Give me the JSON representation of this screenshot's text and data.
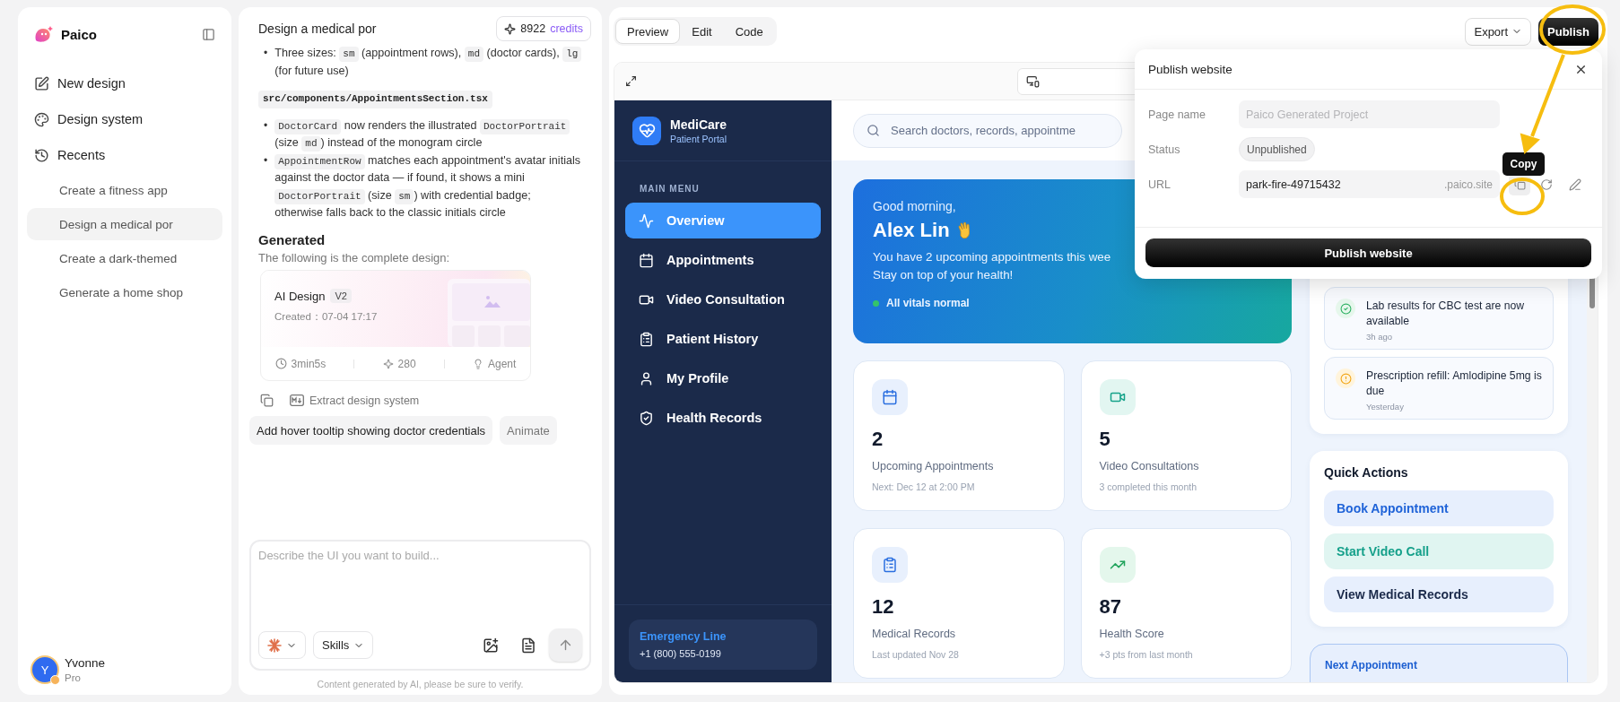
{
  "sidebar": {
    "brand": "Paico",
    "nav": [
      {
        "label": "New design"
      },
      {
        "label": "Design system"
      },
      {
        "label": "Recents"
      }
    ],
    "recents": [
      {
        "label": "Create a fitness app",
        "selected": false
      },
      {
        "label": "Design a medical por",
        "selected": true
      },
      {
        "label": "Create a dark-themed",
        "selected": false
      },
      {
        "label": "Generate a home shop",
        "selected": false
      }
    ],
    "user": {
      "initial": "Y",
      "name": "Yvonne",
      "plan": "Pro"
    }
  },
  "chat": {
    "title": "Design a medical por",
    "credits": {
      "amount": "8922",
      "label": "credits"
    },
    "blocks": [
      {
        "kind": "bullets",
        "marker": "•",
        "items": [
          [
            {
              "kind": "text",
              "text": "Three sizes: "
            },
            {
              "kind": "code",
              "text": "sm"
            },
            {
              "kind": "text",
              "text": " (appointment rows), "
            },
            {
              "kind": "code",
              "text": "md"
            },
            {
              "kind": "text",
              "text": " (doctor cards), "
            },
            {
              "kind": "code",
              "text": "lg"
            },
            {
              "kind": "text",
              "text": " (for future use)"
            }
          ]
        ]
      },
      {
        "kind": "code",
        "text": "src/components/AppointmentsSection.tsx"
      },
      {
        "kind": "bullets",
        "marker": "•",
        "items": [
          [
            {
              "kind": "code",
              "text": "DoctorCard"
            },
            {
              "kind": "text",
              "text": " now renders the illustrated "
            },
            {
              "kind": "code",
              "text": "DoctorPortrait"
            },
            {
              "kind": "text",
              "text": " (size "
            },
            {
              "kind": "code",
              "text": "md"
            },
            {
              "kind": "text",
              "text": ") instead of the monogram circle"
            }
          ],
          [
            {
              "kind": "code",
              "text": "AppointmentRow"
            },
            {
              "kind": "text",
              "text": " matches each appointment's avatar initials against the doctor data — if found, it shows a mini "
            },
            {
              "kind": "code",
              "text": "DoctorPortrait"
            },
            {
              "kind": "text",
              "text": " (size "
            },
            {
              "kind": "code",
              "text": "sm"
            },
            {
              "kind": "text",
              "text": ") with credential badge; otherwise falls back to the classic initials circle"
            }
          ]
        ]
      },
      {
        "kind": "heading",
        "text": "Generated"
      },
      {
        "kind": "paragraph",
        "text": "The following is the complete design:"
      }
    ],
    "design": {
      "title": "AI Design",
      "version": "V2",
      "created": "Created：07-04 17:17",
      "duration": "3min5s",
      "credits": "280",
      "mode": "Agent"
    },
    "actions": {
      "extract": "Extract design system"
    },
    "suggestions": [
      "Add hover tooltip showing doctor credentials",
      "Animate"
    ],
    "input": {
      "placeholder": "Describe the UI you want to build...",
      "skills": "Skills"
    },
    "disclaimer": "Content  generated by AI, please be sure to verify."
  },
  "editor": {
    "tabs": [
      {
        "label": "Preview",
        "selected": true
      },
      {
        "label": "Edit",
        "selected": false
      },
      {
        "label": "Code",
        "selected": false
      }
    ],
    "export": "Export",
    "publish": "Publish"
  },
  "preview": {
    "brand": "MediCare",
    "subtitle": "Patient Portal",
    "menu_title": "MAIN MENU",
    "menu": [
      {
        "label": "Overview",
        "selected": true
      },
      {
        "label": "Appointments",
        "selected": false
      },
      {
        "label": "Video Consultation",
        "selected": false
      },
      {
        "label": "Patient History",
        "selected": false
      },
      {
        "label": "My Profile",
        "selected": false
      },
      {
        "label": "Health Records",
        "selected": false
      }
    ],
    "emergency": {
      "title": "Emergency Line",
      "phone": "+1 (800) 555-0199"
    },
    "search": {
      "placeholder": "Search doctors, records, appointme"
    },
    "greeting": {
      "hello": "Good morning,",
      "name": "Alex Lin",
      "lines": [
        "You have 2 upcoming appointments this wee",
        "Stay on top of your health!"
      ],
      "status": "All vitals normal"
    },
    "stats": [
      {
        "value": "2",
        "label": "Upcoming Appointments",
        "note": "Next: Dec 12 at 2:00 PM"
      },
      {
        "value": "5",
        "label": "Video Consultations",
        "note": "3 completed this month"
      },
      {
        "value": "12",
        "label": "Medical Records",
        "note": "Last updated Nov 28"
      },
      {
        "value": "87",
        "label": "Health Score",
        "note": "+3 pts from last month"
      }
    ],
    "notifications": [
      {
        "kind": "success",
        "text": "Lab results for CBC test are now available",
        "time": "3h ago"
      },
      {
        "kind": "warning",
        "text": "Prescription refill: Amlodipine 5mg is due",
        "time": "Yesterday"
      }
    ],
    "quick_actions": {
      "title": "Quick Actions",
      "items": [
        {
          "label": "Book Appointment",
          "kind": "primary"
        },
        {
          "label": "Start Video Call",
          "kind": "video"
        },
        {
          "label": "View Medical Records",
          "kind": "neutral"
        }
      ]
    },
    "next_appointment": {
      "title": "Next Appointment"
    }
  },
  "publish_dialog": {
    "title": "Publish website",
    "page_name": {
      "label": "Page name",
      "placeholder": "Paico Generated Project"
    },
    "status": {
      "label": "Status",
      "value": "Unpublished"
    },
    "url": {
      "label": "URL",
      "value": "park-fire-49715432",
      "suffix": ".paico.site"
    },
    "tooltip": "Copy",
    "button": "Publish website"
  }
}
